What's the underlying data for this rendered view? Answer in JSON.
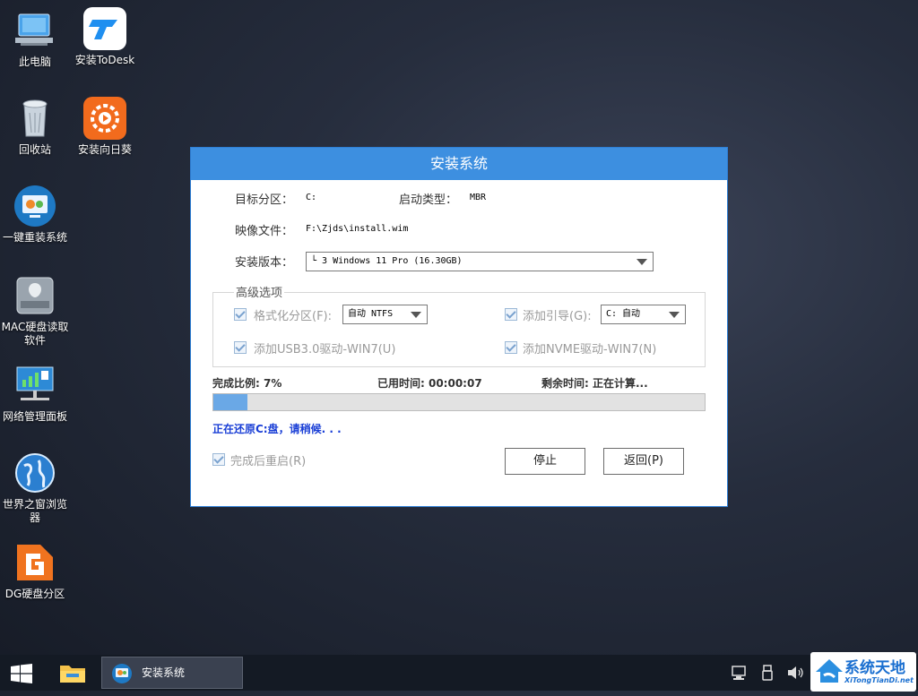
{
  "desktop": {
    "icons": [
      {
        "label": "此电脑",
        "icon": "computer-icon"
      },
      {
        "label": "安装ToDesk",
        "icon": "todesk-icon"
      },
      {
        "label": "回收站",
        "icon": "recycle-bin-icon"
      },
      {
        "label": "安装向日葵",
        "icon": "sunflower-icon"
      },
      {
        "label": "一键重装系统",
        "icon": "reinstall-system-icon"
      },
      {
        "label": "MAC硬盘读取软件",
        "icon": "mac-disk-icon"
      },
      {
        "label": "网络管理面板",
        "icon": "network-panel-icon"
      },
      {
        "label": "世界之窗浏览器",
        "icon": "browser-globe-icon"
      },
      {
        "label": "DG硬盘分区",
        "icon": "dg-partition-icon"
      }
    ]
  },
  "dialog": {
    "title": "安装系统",
    "target_partition_label": "目标分区：",
    "target_partition_value": "C:",
    "boot_type_label": "启动类型：",
    "boot_type_value": "MBR",
    "image_file_label": "映像文件：",
    "image_file_value": "F:\\Zjds\\install.wim",
    "version_label": "安装版本：",
    "version_value": "└ 3 Windows 11 Pro (16.30GB)",
    "advanced_title": "高级选项",
    "format_label": "格式化分区(F):",
    "format_value": "自动 NTFS",
    "boot_add_label": "添加引导(G):",
    "boot_add_value": "C: 自动",
    "usb3_label": "添加USB3.0驱动-WIN7(U)",
    "nvme_label": "添加NVME驱动-WIN7(N)",
    "progress_label": "完成比例: 7%",
    "progress_percent": 7,
    "elapsed_label": "已用时间: 00:00:07",
    "remaining_label": "剩余时间: 正在计算...",
    "status_text": "正在还原C:盘，请稍候. . .",
    "restart_label": "完成后重启(R)",
    "stop_button": "停止",
    "back_button": "返回(P)"
  },
  "taskbar": {
    "active_app": "安装系统",
    "watermark_brand": "系统天地",
    "watermark_url": "XiTongTianDi.net"
  },
  "colors": {
    "accent": "#3d8fe0",
    "status_text": "#1a3fd6",
    "progress_fill": "#6aa8e6"
  }
}
